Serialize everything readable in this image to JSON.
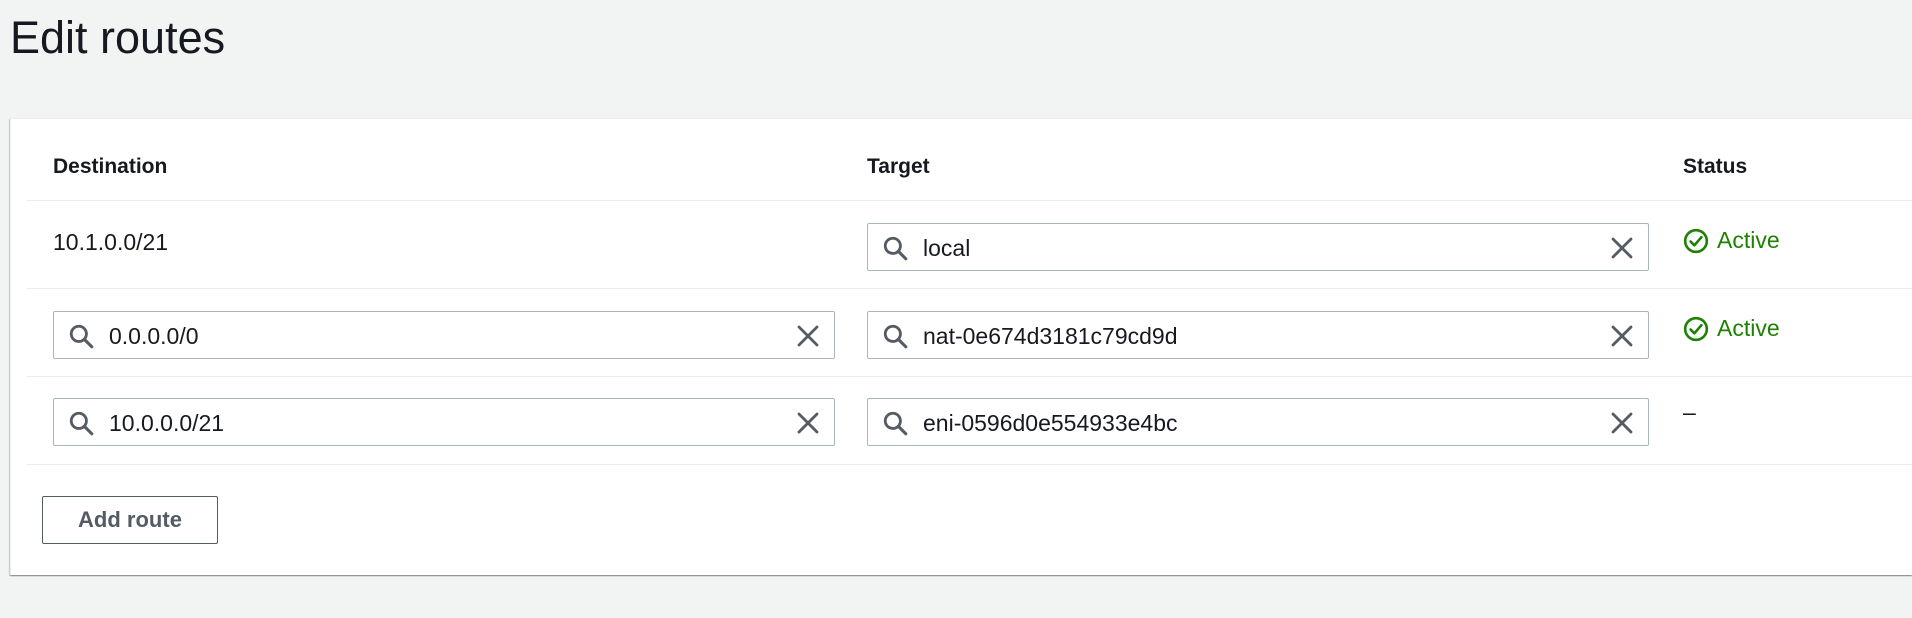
{
  "page": {
    "title": "Edit routes"
  },
  "table": {
    "columns": {
      "destination": "Destination",
      "target": "Target",
      "status": "Status"
    },
    "rows": [
      {
        "destination": "10.1.0.0/21",
        "destination_editable": false,
        "target": "local",
        "status": "Active"
      },
      {
        "destination": "0.0.0.0/0",
        "destination_editable": true,
        "target": "nat-0e674d3181c79cd9d",
        "status": "Active"
      },
      {
        "destination": "10.0.0.0/21",
        "destination_editable": true,
        "target": "eni-0596d0e554933e4bc",
        "status": "–"
      }
    ]
  },
  "actions": {
    "add_route_label": "Add route"
  },
  "icons": {
    "search": "search-icon",
    "clear": "close-icon",
    "status_ok": "check-circle-icon"
  },
  "colors": {
    "status_active": "#1d8102",
    "icon_gray": "#545b64",
    "border": "#aab7b8",
    "background": "#f2f3f3"
  }
}
